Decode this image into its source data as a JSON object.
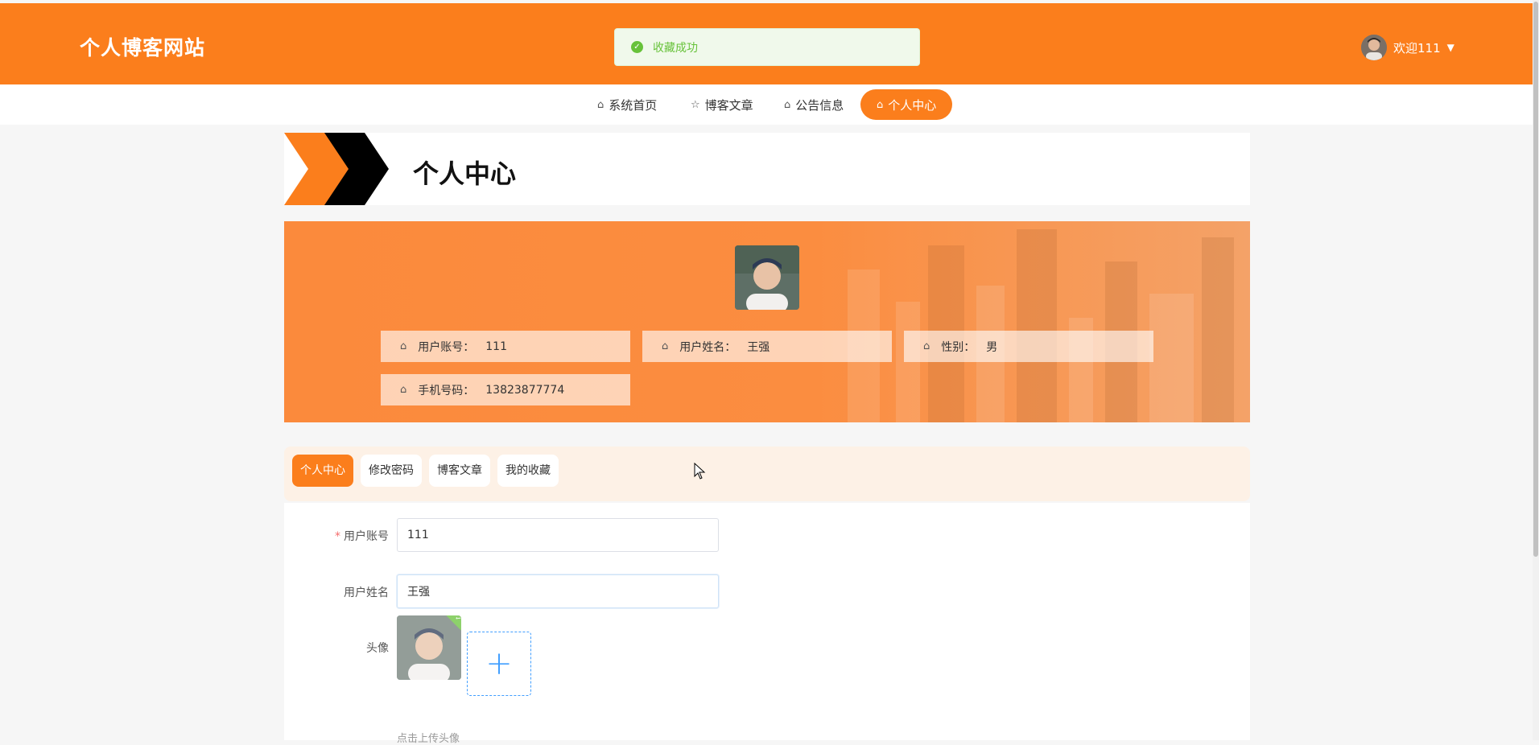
{
  "header": {
    "site_title": "个人博客网站",
    "toast": {
      "icon": "check-circle-icon",
      "text": "收藏成功",
      "color": "#67c23a"
    },
    "user": {
      "welcome": "欢迎111",
      "caret": "▼"
    },
    "accent_color": "#fb7e1c"
  },
  "nav": {
    "items": [
      {
        "label": "系统首页",
        "icon": "home-icon"
      },
      {
        "label": "博客文章",
        "icon": "star-icon"
      },
      {
        "label": "公告信息",
        "icon": "bag-icon"
      },
      {
        "label": "个人中心",
        "icon": "home-icon",
        "active": true
      }
    ]
  },
  "page": {
    "title": "个人中心"
  },
  "profile": {
    "account_label": "用户账号：",
    "account_value": "111",
    "name_label": "用户姓名：",
    "name_value": "王强",
    "gender_label": "性别：",
    "gender_value": "男",
    "phone_label": "手机号码：",
    "phone_value": "13823877774"
  },
  "tabs": [
    {
      "label": "个人中心",
      "active": true
    },
    {
      "label": "修改密码"
    },
    {
      "label": "博客文章"
    },
    {
      "label": "我的收藏"
    }
  ],
  "form": {
    "account": {
      "label": "用户账号",
      "required_mark": "*",
      "value": "111"
    },
    "name": {
      "label": "用户姓名",
      "value": "王强"
    },
    "avatar": {
      "label": "头像",
      "hint": "点击上传头像"
    }
  }
}
